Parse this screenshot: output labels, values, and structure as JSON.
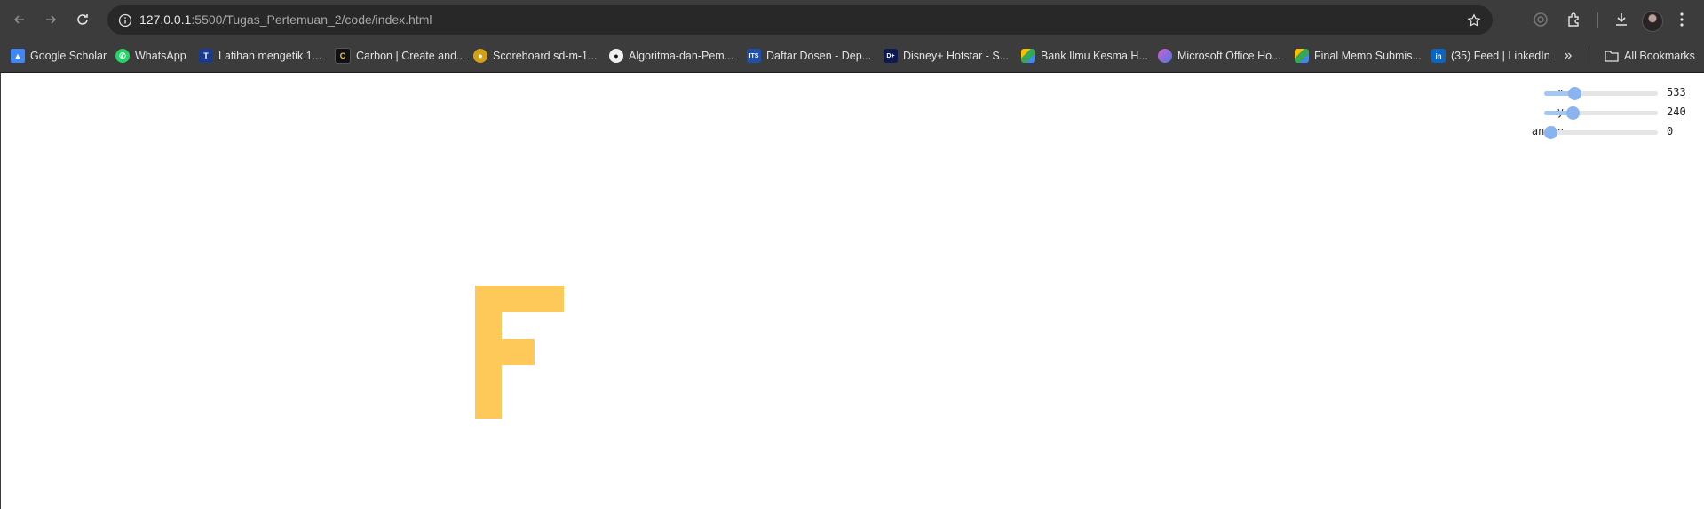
{
  "browser": {
    "url_host": "127.0.0.1",
    "url_rest": ":5500/Tugas_Pertemuan_2/code/index.html"
  },
  "bookmarks": [
    {
      "label": "Google Scholar",
      "icon": "scholar-icon",
      "color": "#4285f4"
    },
    {
      "label": "WhatsApp",
      "icon": "whatsapp-icon",
      "color": "#25d366"
    },
    {
      "label": "Latihan mengetik 1...",
      "icon": "typing-icon",
      "color": "#1a3a8f"
    },
    {
      "label": "Carbon | Create and...",
      "icon": "carbon-icon",
      "color": "#111111"
    },
    {
      "label": "Scoreboard sd-m-1...",
      "icon": "scoreboard-icon",
      "color": "#d4a017"
    },
    {
      "label": "Algoritma-dan-Pem...",
      "icon": "github-icon",
      "color": "#f0f0f0"
    },
    {
      "label": "Daftar Dosen - Dep...",
      "icon": "its-icon",
      "color": "#1f4fa8"
    },
    {
      "label": "Disney+ Hotstar - S...",
      "icon": "disney-icon",
      "color": "#0e1a4f"
    },
    {
      "label": "Bank Ilmu Kesma H...",
      "icon": "drive-icon",
      "color": "#34a853"
    },
    {
      "label": "Microsoft Office Ho...",
      "icon": "office-icon",
      "color": "#7b5cd6"
    },
    {
      "label": "Final Memo Submis...",
      "icon": "drive-icon",
      "color": "#34a853"
    },
    {
      "label": "(35) Feed | LinkedIn",
      "icon": "linkedin-icon",
      "color": "#0a66c2"
    }
  ],
  "all_bookmarks_label": "All Bookmarks",
  "controls": [
    {
      "label": "x",
      "value": "533",
      "fraction": 0.24
    },
    {
      "label": "y",
      "value": "240",
      "fraction": 0.22
    },
    {
      "label": "angle",
      "value": "0",
      "fraction": 0.0
    }
  ],
  "shape": {
    "letter": "F",
    "color": "#ffc95a"
  }
}
